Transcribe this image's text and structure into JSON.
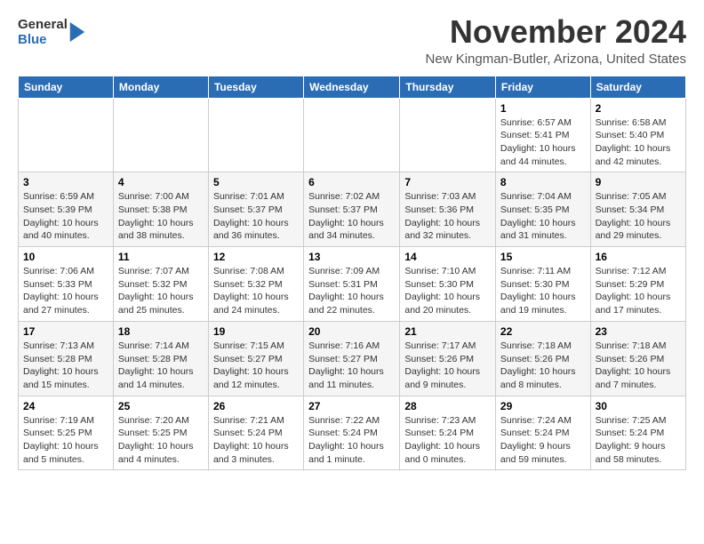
{
  "logo": {
    "general": "General",
    "blue": "Blue",
    "arrow_color": "#2b6db5"
  },
  "title": "November 2024",
  "location": "New Kingman-Butler, Arizona, United States",
  "headers": [
    "Sunday",
    "Monday",
    "Tuesday",
    "Wednesday",
    "Thursday",
    "Friday",
    "Saturday"
  ],
  "weeks": [
    [
      {
        "day": "",
        "info": ""
      },
      {
        "day": "",
        "info": ""
      },
      {
        "day": "",
        "info": ""
      },
      {
        "day": "",
        "info": ""
      },
      {
        "day": "",
        "info": ""
      },
      {
        "day": "1",
        "info": "Sunrise: 6:57 AM\nSunset: 5:41 PM\nDaylight: 10 hours\nand 44 minutes."
      },
      {
        "day": "2",
        "info": "Sunrise: 6:58 AM\nSunset: 5:40 PM\nDaylight: 10 hours\nand 42 minutes."
      }
    ],
    [
      {
        "day": "3",
        "info": "Sunrise: 6:59 AM\nSunset: 5:39 PM\nDaylight: 10 hours\nand 40 minutes."
      },
      {
        "day": "4",
        "info": "Sunrise: 7:00 AM\nSunset: 5:38 PM\nDaylight: 10 hours\nand 38 minutes."
      },
      {
        "day": "5",
        "info": "Sunrise: 7:01 AM\nSunset: 5:37 PM\nDaylight: 10 hours\nand 36 minutes."
      },
      {
        "day": "6",
        "info": "Sunrise: 7:02 AM\nSunset: 5:37 PM\nDaylight: 10 hours\nand 34 minutes."
      },
      {
        "day": "7",
        "info": "Sunrise: 7:03 AM\nSunset: 5:36 PM\nDaylight: 10 hours\nand 32 minutes."
      },
      {
        "day": "8",
        "info": "Sunrise: 7:04 AM\nSunset: 5:35 PM\nDaylight: 10 hours\nand 31 minutes."
      },
      {
        "day": "9",
        "info": "Sunrise: 7:05 AM\nSunset: 5:34 PM\nDaylight: 10 hours\nand 29 minutes."
      }
    ],
    [
      {
        "day": "10",
        "info": "Sunrise: 7:06 AM\nSunset: 5:33 PM\nDaylight: 10 hours\nand 27 minutes."
      },
      {
        "day": "11",
        "info": "Sunrise: 7:07 AM\nSunset: 5:32 PM\nDaylight: 10 hours\nand 25 minutes."
      },
      {
        "day": "12",
        "info": "Sunrise: 7:08 AM\nSunset: 5:32 PM\nDaylight: 10 hours\nand 24 minutes."
      },
      {
        "day": "13",
        "info": "Sunrise: 7:09 AM\nSunset: 5:31 PM\nDaylight: 10 hours\nand 22 minutes."
      },
      {
        "day": "14",
        "info": "Sunrise: 7:10 AM\nSunset: 5:30 PM\nDaylight: 10 hours\nand 20 minutes."
      },
      {
        "day": "15",
        "info": "Sunrise: 7:11 AM\nSunset: 5:30 PM\nDaylight: 10 hours\nand 19 minutes."
      },
      {
        "day": "16",
        "info": "Sunrise: 7:12 AM\nSunset: 5:29 PM\nDaylight: 10 hours\nand 17 minutes."
      }
    ],
    [
      {
        "day": "17",
        "info": "Sunrise: 7:13 AM\nSunset: 5:28 PM\nDaylight: 10 hours\nand 15 minutes."
      },
      {
        "day": "18",
        "info": "Sunrise: 7:14 AM\nSunset: 5:28 PM\nDaylight: 10 hours\nand 14 minutes."
      },
      {
        "day": "19",
        "info": "Sunrise: 7:15 AM\nSunset: 5:27 PM\nDaylight: 10 hours\nand 12 minutes."
      },
      {
        "day": "20",
        "info": "Sunrise: 7:16 AM\nSunset: 5:27 PM\nDaylight: 10 hours\nand 11 minutes."
      },
      {
        "day": "21",
        "info": "Sunrise: 7:17 AM\nSunset: 5:26 PM\nDaylight: 10 hours\nand 9 minutes."
      },
      {
        "day": "22",
        "info": "Sunrise: 7:18 AM\nSunset: 5:26 PM\nDaylight: 10 hours\nand 8 minutes."
      },
      {
        "day": "23",
        "info": "Sunrise: 7:18 AM\nSunset: 5:26 PM\nDaylight: 10 hours\nand 7 minutes."
      }
    ],
    [
      {
        "day": "24",
        "info": "Sunrise: 7:19 AM\nSunset: 5:25 PM\nDaylight: 10 hours\nand 5 minutes."
      },
      {
        "day": "25",
        "info": "Sunrise: 7:20 AM\nSunset: 5:25 PM\nDaylight: 10 hours\nand 4 minutes."
      },
      {
        "day": "26",
        "info": "Sunrise: 7:21 AM\nSunset: 5:24 PM\nDaylight: 10 hours\nand 3 minutes."
      },
      {
        "day": "27",
        "info": "Sunrise: 7:22 AM\nSunset: 5:24 PM\nDaylight: 10 hours\nand 1 minute."
      },
      {
        "day": "28",
        "info": "Sunrise: 7:23 AM\nSunset: 5:24 PM\nDaylight: 10 hours\nand 0 minutes."
      },
      {
        "day": "29",
        "info": "Sunrise: 7:24 AM\nSunset: 5:24 PM\nDaylight: 9 hours\nand 59 minutes."
      },
      {
        "day": "30",
        "info": "Sunrise: 7:25 AM\nSunset: 5:24 PM\nDaylight: 9 hours\nand 58 minutes."
      }
    ]
  ]
}
